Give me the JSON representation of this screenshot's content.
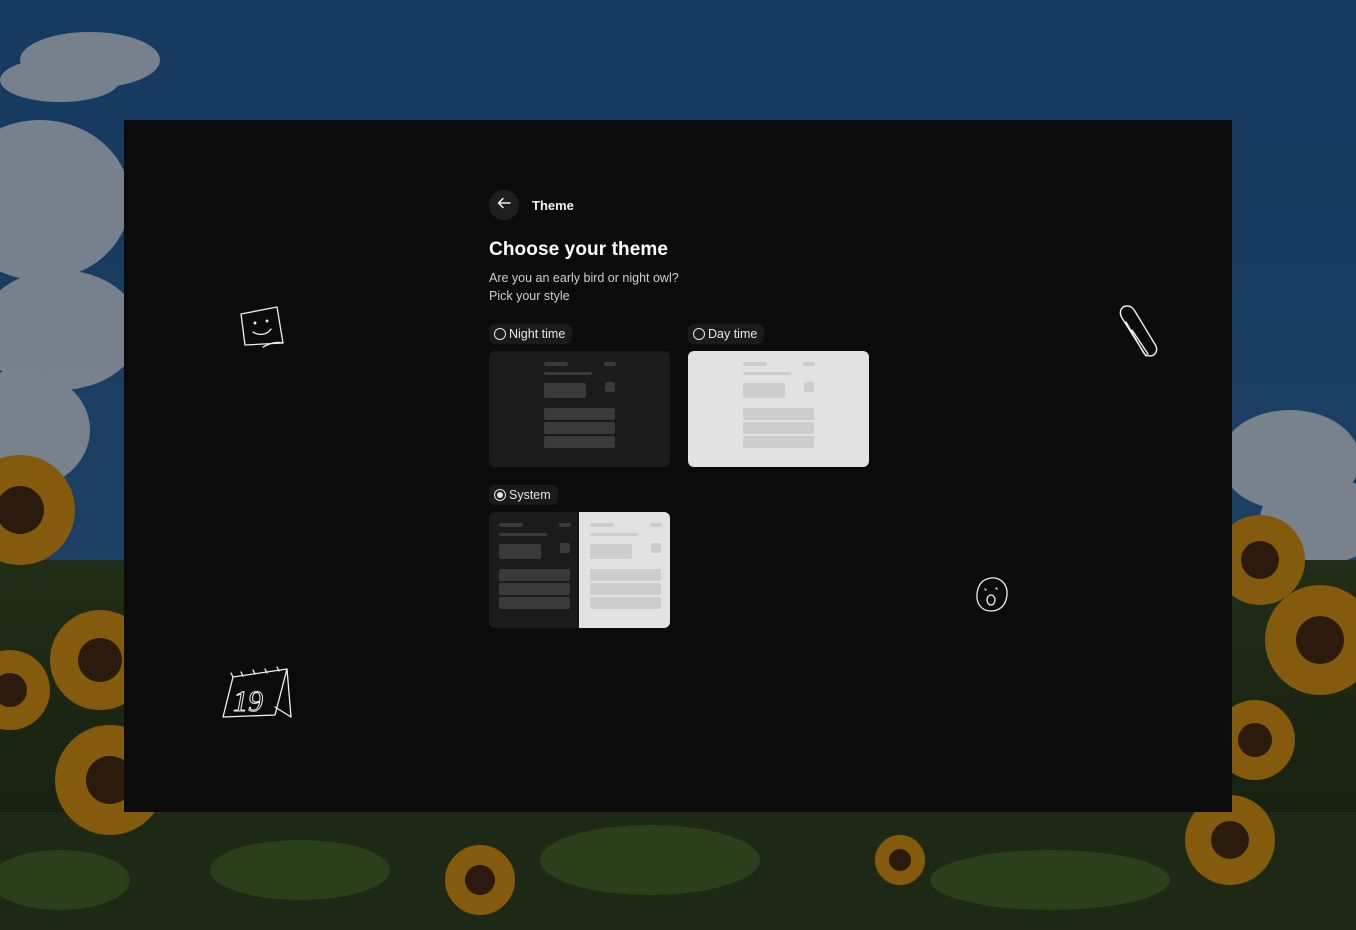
{
  "header": {
    "back_icon": "arrow-left-icon",
    "title": "Theme"
  },
  "main": {
    "heading": "Choose your theme",
    "subtitle_line1": "Are you an early bird or night owl?",
    "subtitle_line2": "Pick your style"
  },
  "options": [
    {
      "id": "night",
      "label": "Night time",
      "selected": false
    },
    {
      "id": "day",
      "label": "Day time",
      "selected": false
    },
    {
      "id": "system",
      "label": "System",
      "selected": true
    }
  ],
  "doodles": {
    "sticky_note": "sticky-note-smile-icon",
    "paperclip": "paperclip-icon",
    "calendar_day": "19",
    "face": "surprised-face-icon"
  },
  "colors": {
    "window_bg": "#0b0b0b",
    "dark_preview": "#1b1b1b",
    "light_preview": "#e2e2e2",
    "text": "#ffffff"
  }
}
